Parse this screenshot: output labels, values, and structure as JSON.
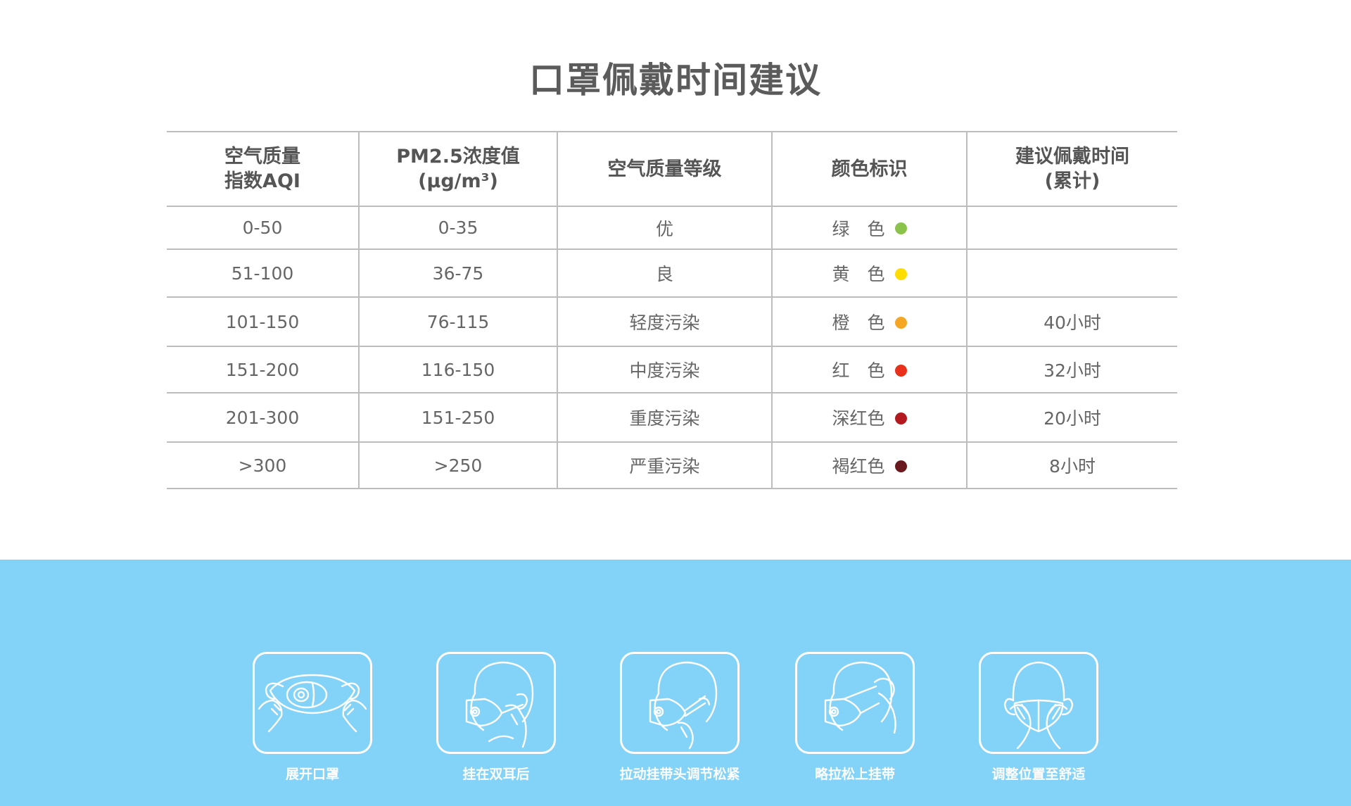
{
  "title": "口罩佩戴时间建议",
  "table": {
    "headers": [
      [
        "空气质量",
        "指数AQI"
      ],
      [
        "PM2.5浓度值",
        "(μg/m³)"
      ],
      [
        "空气质量等级",
        ""
      ],
      [
        "颜色标识",
        ""
      ],
      [
        "建议佩戴时间",
        "(累计)"
      ]
    ],
    "rows": [
      {
        "aqi": "0-50",
        "pm": "0-35",
        "level": "优",
        "color_label": "绿　色",
        "color": "#8bc34a",
        "time": ""
      },
      {
        "aqi": "51-100",
        "pm": "36-75",
        "level": "良",
        "color_label": "黄　色",
        "color": "#ffdd00",
        "time": ""
      },
      {
        "aqi": "101-150",
        "pm": "76-115",
        "level": "轻度污染",
        "color_label": "橙　色",
        "color": "#f5a623",
        "time": "40小时"
      },
      {
        "aqi": "151-200",
        "pm": "116-150",
        "level": "中度污染",
        "color_label": "红　色",
        "color": "#e8301a",
        "time": "32小时"
      },
      {
        "aqi": "201-300",
        "pm": "151-250",
        "level": "重度污染",
        "color_label": "深红色",
        "color": "#b3191e",
        "time": "20小时"
      },
      {
        "aqi": ">300",
        "pm": ">250",
        "level": "严重污染",
        "color_label": "褐红色",
        "color": "#6a1a1e",
        "time": "8小时"
      }
    ],
    "row_heights": [
      61,
      68,
      70,
      66,
      70,
      66
    ]
  },
  "steps": [
    {
      "caption": "展开口罩",
      "icon": "unfold-mask-icon"
    },
    {
      "caption": "挂在双耳后",
      "icon": "hang-ears-icon"
    },
    {
      "caption": "拉动挂带头调节松紧",
      "icon": "adjust-strap-icon"
    },
    {
      "caption": "略拉松上挂带",
      "icon": "loosen-strap-icon"
    },
    {
      "caption": "调整位置至舒适",
      "icon": "adjust-position-icon"
    }
  ],
  "colors": {
    "accent_bg": "#83d3f8",
    "grid": "#bdbdbd",
    "title": "#5b5b5b"
  }
}
